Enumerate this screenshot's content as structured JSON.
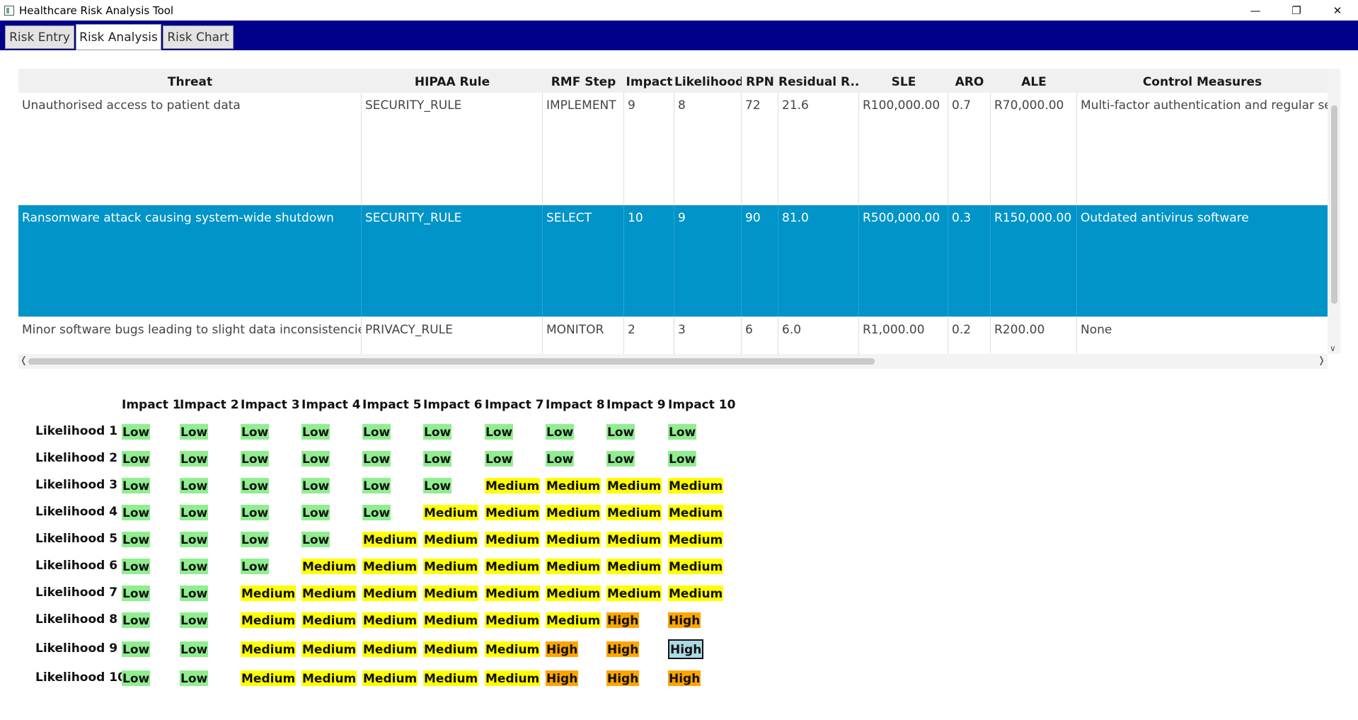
{
  "window": {
    "title": "Healthcare Risk Analysis Tool",
    "controls": {
      "minimize": "—",
      "restore": "❐",
      "close": "✕"
    }
  },
  "tabs": [
    {
      "label": "Risk Entry",
      "active": false
    },
    {
      "label": "Risk Analysis",
      "active": true
    },
    {
      "label": "Risk Chart",
      "active": false
    }
  ],
  "table": {
    "columns": [
      "Threat",
      "HIPAA Rule",
      "RMF Step",
      "Impact",
      "Likelihood",
      "RPN",
      "Residual R...",
      "SLE",
      "ARO",
      "ALE",
      "Control Measures"
    ],
    "rows": [
      {
        "selected": false,
        "cells": [
          "Unauthorised access to patient data",
          "SECURITY_RULE",
          "IMPLEMENT",
          "9",
          "8",
          "72",
          "21.6",
          "R100,000.00",
          "0.7",
          "R70,000.00",
          "Multi-factor authentication and regular secu"
        ]
      },
      {
        "selected": true,
        "cells": [
          "Ransomware attack causing system-wide shutdown",
          "SECURITY_RULE",
          "SELECT",
          "10",
          "9",
          "90",
          "81.0",
          "R500,000.00",
          "0.3",
          "R150,000.00",
          "Outdated antivirus software"
        ]
      },
      {
        "selected": false,
        "cells": [
          "Minor software bugs leading to slight data inconsistencies",
          "PRIVACY_RULE",
          "MONITOR",
          "2",
          "3",
          "6",
          "6.0",
          "R1,000.00",
          "0.2",
          "R200.00",
          "None"
        ]
      }
    ]
  },
  "matrix": {
    "impact_headers": [
      "Impact 1",
      "Impact 2",
      "Impact 3",
      "Impact 4",
      "Impact 5",
      "Impact 6",
      "Impact 7",
      "Impact 8",
      "Impact 9",
      "Impact 10"
    ],
    "likelihood_labels": [
      "Likelihood 1",
      "Likelihood 2",
      "Likelihood 3",
      "Likelihood 4",
      "Likelihood 5",
      "Likelihood 6",
      "Likelihood 7",
      "Likelihood 8",
      "Likelihood 9",
      "Likelihood 10"
    ],
    "cells": [
      [
        "Low",
        "Low",
        "Low",
        "Low",
        "Low",
        "Low",
        "Low",
        "Low",
        "Low",
        "Low"
      ],
      [
        "Low",
        "Low",
        "Low",
        "Low",
        "Low",
        "Low",
        "Low",
        "Low",
        "Low",
        "Low"
      ],
      [
        "Low",
        "Low",
        "Low",
        "Low",
        "Low",
        "Low",
        "Medium",
        "Medium",
        "Medium",
        "Medium"
      ],
      [
        "Low",
        "Low",
        "Low",
        "Low",
        "Low",
        "Medium",
        "Medium",
        "Medium",
        "Medium",
        "Medium"
      ],
      [
        "Low",
        "Low",
        "Low",
        "Low",
        "Medium",
        "Medium",
        "Medium",
        "Medium",
        "Medium",
        "Medium"
      ],
      [
        "Low",
        "Low",
        "Low",
        "Medium",
        "Medium",
        "Medium",
        "Medium",
        "Medium",
        "Medium",
        "Medium"
      ],
      [
        "Low",
        "Low",
        "Medium",
        "Medium",
        "Medium",
        "Medium",
        "Medium",
        "Medium",
        "Medium",
        "Medium"
      ],
      [
        "Low",
        "Low",
        "Medium",
        "Medium",
        "Medium",
        "Medium",
        "Medium",
        "Medium",
        "High",
        "High"
      ],
      [
        "Low",
        "Low",
        "Medium",
        "Medium",
        "Medium",
        "Medium",
        "Medium",
        "High",
        "High",
        "High"
      ],
      [
        "Low",
        "Low",
        "Medium",
        "Medium",
        "Medium",
        "Medium",
        "Medium",
        "High",
        "High",
        "High"
      ]
    ],
    "selected_cell": {
      "likelihood": 9,
      "impact": 10
    },
    "colors": {
      "Low": "#90ee90",
      "Medium": "#ffff00",
      "High": "#ffa500",
      "selected": "#add8e6"
    }
  }
}
